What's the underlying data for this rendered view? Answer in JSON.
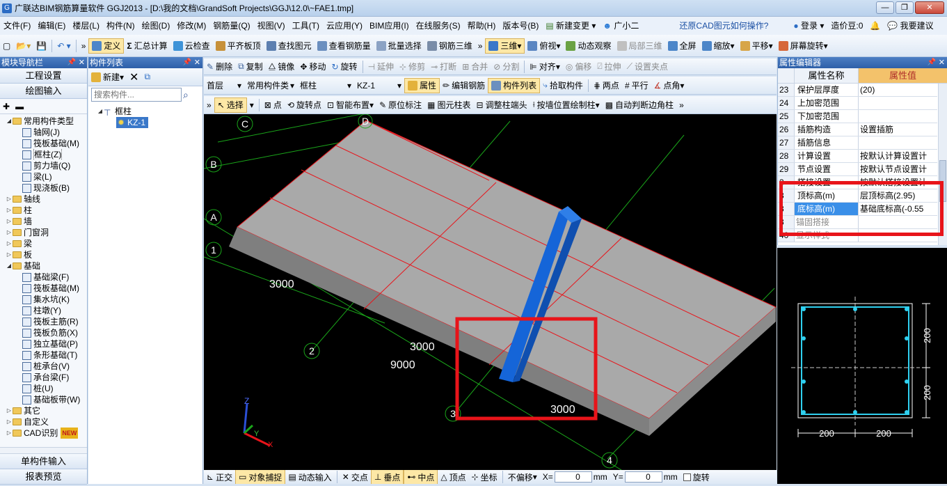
{
  "window": {
    "title": "广联达BIM钢筋算量软件 GGJ2013 - [D:\\我的文档\\GrandSoft Projects\\GGJ\\12.0\\~FAE1.tmp]",
    "min": "—",
    "max": "❐",
    "close": "✕"
  },
  "menu": {
    "items": [
      "文件(F)",
      "编辑(E)",
      "楼层(L)",
      "构件(N)",
      "绘图(D)",
      "修改(M)",
      "钢筋量(Q)",
      "视图(V)",
      "工具(T)",
      "云应用(Y)",
      "BIM应用(I)",
      "在线服务(S)",
      "帮助(H)",
      "版本号(B)",
      "新建变更",
      "广小二"
    ],
    "right_link": "还原CAD图元如何操作?",
    "login": "登录",
    "zaojiadou": "造价豆:0",
    "suggest": "我要建议"
  },
  "toolbar1": {
    "define": "定义",
    "sum": "汇总计算",
    "cloud": "云检查",
    "level": "平齐板顶",
    "find": "查找图元",
    "view_rebar": "查看钢筋量",
    "batch": "批量选择",
    "rebar3d": "钢筋三维",
    "view3d": "三维",
    "top": "俯视",
    "dynamic": "动态观察",
    "local3d": "局部三维",
    "full": "全屏",
    "zoom": "缩放",
    "pan": "平移",
    "rotate": "屏幕旋转"
  },
  "left_panel": {
    "title": "模块导航栏",
    "btn_project": "工程设置",
    "btn_draw": "绘图输入",
    "btn_single": "单构件输入",
    "btn_report": "报表预览",
    "tree": [
      {
        "label": "常用构件类型",
        "level": 0,
        "folder": true,
        "open": true
      },
      {
        "label": "轴网(J)",
        "level": 1
      },
      {
        "label": "筏板基础(M)",
        "level": 1
      },
      {
        "label": "框柱(Z)",
        "level": 1
      },
      {
        "label": "剪力墙(Q)",
        "level": 1
      },
      {
        "label": "梁(L)",
        "level": 1
      },
      {
        "label": "现浇板(B)",
        "level": 1
      },
      {
        "label": "轴线",
        "level": 0,
        "folder": true
      },
      {
        "label": "柱",
        "level": 0,
        "folder": true
      },
      {
        "label": "墙",
        "level": 0,
        "folder": true
      },
      {
        "label": "门窗洞",
        "level": 0,
        "folder": true
      },
      {
        "label": "梁",
        "level": 0,
        "folder": true
      },
      {
        "label": "板",
        "level": 0,
        "folder": true
      },
      {
        "label": "基础",
        "level": 0,
        "folder": true,
        "open": true
      },
      {
        "label": "基础梁(F)",
        "level": 1
      },
      {
        "label": "筏板基础(M)",
        "level": 1
      },
      {
        "label": "集水坑(K)",
        "level": 1
      },
      {
        "label": "柱墩(Y)",
        "level": 1
      },
      {
        "label": "筏板主筋(R)",
        "level": 1
      },
      {
        "label": "筏板负筋(X)",
        "level": 1
      },
      {
        "label": "独立基础(P)",
        "level": 1
      },
      {
        "label": "条形基础(T)",
        "level": 1
      },
      {
        "label": "桩承台(V)",
        "level": 1
      },
      {
        "label": "承台梁(F)",
        "level": 1
      },
      {
        "label": "桩(U)",
        "level": 1
      },
      {
        "label": "基础板带(W)",
        "level": 1
      },
      {
        "label": "其它",
        "level": 0,
        "folder": true
      },
      {
        "label": "自定义",
        "level": 0,
        "folder": true
      },
      {
        "label": "CAD识别",
        "level": 0,
        "folder": true,
        "badge": "NEW"
      }
    ]
  },
  "comp_panel": {
    "title": "构件列表",
    "new": "新建",
    "search_placeholder": "搜索构件...",
    "tree_parent": "框柱",
    "tree_child": "KZ-1"
  },
  "edit_toolbar": {
    "delete": "删除",
    "copy": "复制",
    "mirror": "镜像",
    "move": "移动",
    "rotate": "旋转",
    "extend": "延伸",
    "trim": "修剪",
    "break": "打断",
    "merge": "合并",
    "split": "分割",
    "align": "对齐",
    "offset": "偏移",
    "stretch": "拉伸",
    "set_point": "设置夹点"
  },
  "layer_toolbar": {
    "floor": "首层",
    "type": "常用构件类",
    "comp": "框柱",
    "name": "KZ-1",
    "props": "属性",
    "edit_rebar": "编辑钢筋",
    "comp_list": "构件列表",
    "pick": "拾取构件",
    "two_points": "两点",
    "parallel": "平行",
    "point_angle": "点角"
  },
  "draw_toolbar": {
    "select": "选择",
    "point": "点",
    "rotate_point": "旋转点",
    "smart": "智能布置",
    "orig_mark": "原位标注",
    "col_table": "图元柱表",
    "adjust_end": "调整柱端头",
    "by_wall": "按墙位置绘制柱",
    "auto_corner": "自动判断边角柱"
  },
  "viewport": {
    "axes": [
      "C",
      "D",
      "B",
      "A",
      "1",
      "2",
      "3",
      "4"
    ],
    "dims": [
      "3000",
      "3000",
      "9000",
      "3000"
    ],
    "axis_labels": [
      "Z",
      "Y",
      "X"
    ]
  },
  "prop_panel": {
    "title": "属性编辑器",
    "col_name": "属性名称",
    "col_value": "属性值",
    "rows": [
      {
        "n": "23",
        "k": "保护层厚度",
        "v": "(20)"
      },
      {
        "n": "24",
        "k": "上加密范围",
        "v": ""
      },
      {
        "n": "25",
        "k": "下加密范围",
        "v": ""
      },
      {
        "n": "26",
        "k": "插筋构造",
        "v": "设置插筋"
      },
      {
        "n": "27",
        "k": "插筋信息",
        "v": ""
      },
      {
        "n": "28",
        "k": "计算设置",
        "v": "按默认计算设置计"
      },
      {
        "n": "29",
        "k": "节点设置",
        "v": "按默认节点设置计"
      },
      {
        "n": "3",
        "k": "搭接设置",
        "v": "按默认搭接设置计"
      },
      {
        "n": "3",
        "k": "顶标高(m)",
        "v": "层顶标高(2.95)"
      },
      {
        "n": "3",
        "k": "底标高(m)",
        "v": "基础底标高(-0.55"
      },
      {
        "n": "3",
        "k": "锚固搭接",
        "v": ""
      },
      {
        "n": "40",
        "k": "显示样式",
        "v": ""
      }
    ]
  },
  "section": {
    "dim_h1": "200",
    "dim_h2": "200",
    "dim_v1": "200",
    "dim_v2": "200"
  },
  "statusbar": {
    "ortho": "正交",
    "snap": "对象捕捉",
    "dyn_input": "动态输入",
    "intersect": "交点",
    "perp": "垂点",
    "mid": "中点",
    "vertex": "顶点",
    "coord": "坐标",
    "no_offset": "不偏移",
    "x_label": "X=",
    "x_val": "0",
    "x_unit": "mm",
    "y_label": "Y=",
    "y_val": "0",
    "y_unit": "mm",
    "rotate": "旋转"
  },
  "colors": {
    "highlight_box": "#e8141a",
    "column": "#1565d8",
    "slab": "#a9a9a9",
    "grid": "#1aa51a"
  }
}
